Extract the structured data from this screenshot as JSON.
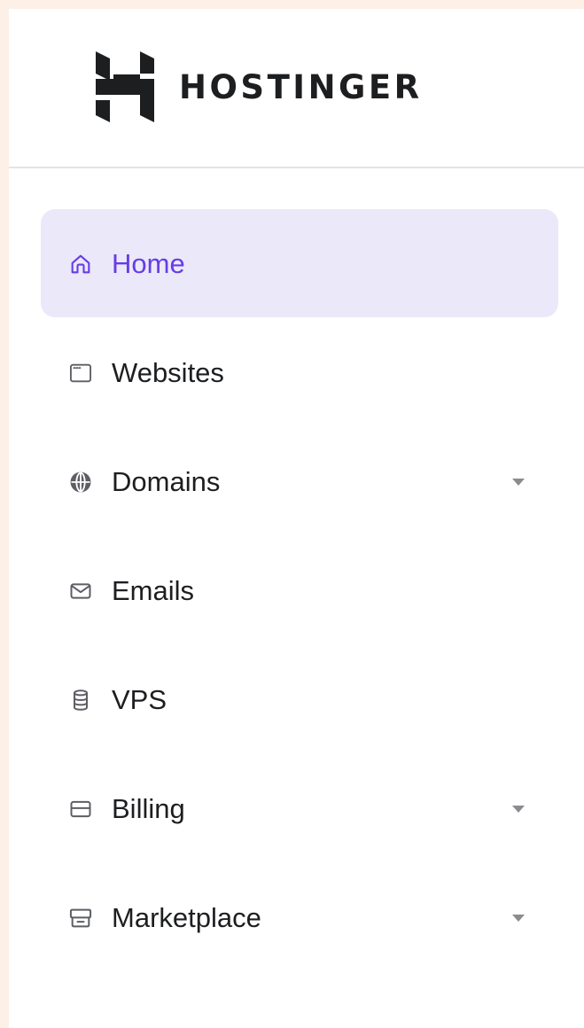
{
  "brand": {
    "name": "HOSTINGER",
    "logo_icon": "hostinger-logo-icon"
  },
  "colors": {
    "accent": "#673de6",
    "active_background": "#ebe8f9",
    "text": "#1d1e20",
    "icon": "#5c5e63",
    "page_background": "#fdf0e6"
  },
  "sidebar": {
    "items": [
      {
        "label": "Home",
        "icon": "home-icon",
        "active": true,
        "has_dropdown": false
      },
      {
        "label": "Websites",
        "icon": "browser-window-icon",
        "active": false,
        "has_dropdown": false
      },
      {
        "label": "Domains",
        "icon": "globe-icon",
        "active": false,
        "has_dropdown": true
      },
      {
        "label": "Emails",
        "icon": "envelope-icon",
        "active": false,
        "has_dropdown": false
      },
      {
        "label": "VPS",
        "icon": "database-icon",
        "active": false,
        "has_dropdown": false
      },
      {
        "label": "Billing",
        "icon": "credit-card-icon",
        "active": false,
        "has_dropdown": true
      },
      {
        "label": "Marketplace",
        "icon": "storefront-icon",
        "active": false,
        "has_dropdown": true
      }
    ]
  }
}
